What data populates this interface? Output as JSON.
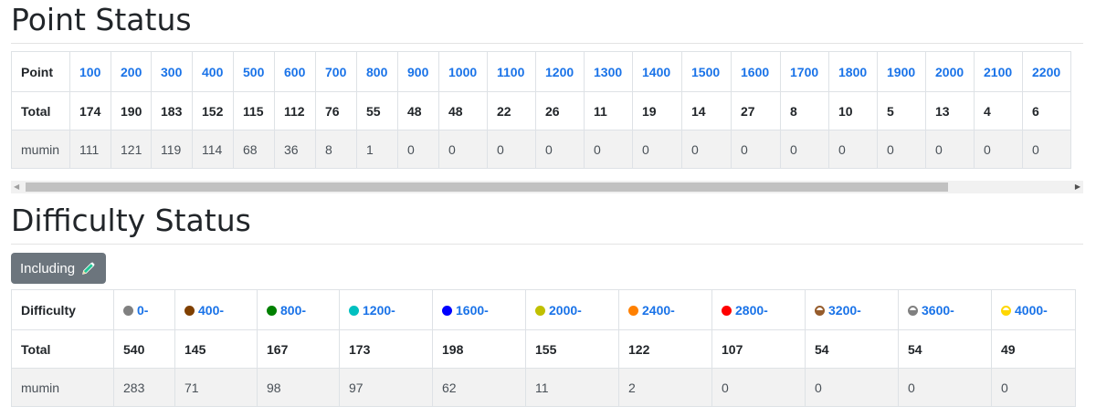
{
  "point_status": {
    "title": "Point Status",
    "header_label": "Point",
    "points": [
      "100",
      "200",
      "300",
      "400",
      "500",
      "600",
      "700",
      "800",
      "900",
      "1000",
      "1100",
      "1200",
      "1300",
      "1400",
      "1500",
      "1600",
      "1700",
      "1800",
      "1900",
      "2000",
      "2100",
      "2200"
    ],
    "total_label": "Total",
    "totals": [
      "174",
      "190",
      "183",
      "152",
      "115",
      "112",
      "76",
      "55",
      "48",
      "48",
      "22",
      "26",
      "11",
      "19",
      "14",
      "27",
      "8",
      "10",
      "5",
      "13",
      "4",
      "6"
    ],
    "user_label": "mumin",
    "user_values": [
      "111",
      "121",
      "119",
      "114",
      "68",
      "36",
      "8",
      "1",
      "0",
      "0",
      "0",
      "0",
      "0",
      "0",
      "0",
      "0",
      "0",
      "0",
      "0",
      "0",
      "0",
      "0"
    ]
  },
  "scrollbar": {
    "left_arrow": "◀",
    "right_arrow": "▶",
    "position_fraction": 0
  },
  "difficulty_status": {
    "title": "Difficulty Status",
    "toggle_label": "Including",
    "header_label": "Difficulty",
    "levels": [
      {
        "label": "0-",
        "color": "#808080"
      },
      {
        "label": "400-",
        "color": "#804000"
      },
      {
        "label": "800-",
        "color": "#008000"
      },
      {
        "label": "1200-",
        "color": "#00c0c0"
      },
      {
        "label": "1600-",
        "color": "#0000ff"
      },
      {
        "label": "2000-",
        "color": "#c0c000"
      },
      {
        "label": "2400-",
        "color": "#ff8000"
      },
      {
        "label": "2800-",
        "color": "#ff0000"
      },
      {
        "label": "3200-",
        "color": "#965c2c"
      },
      {
        "label": "3600-",
        "color": "#808080"
      },
      {
        "label": "4000-",
        "color": "#ffd700"
      }
    ],
    "total_label": "Total",
    "totals": [
      "540",
      "145",
      "167",
      "173",
      "198",
      "155",
      "122",
      "107",
      "54",
      "54",
      "49"
    ],
    "user_label": "mumin",
    "user_values": [
      "283",
      "71",
      "98",
      "97",
      "62",
      "11",
      "2",
      "0",
      "0",
      "0",
      "0"
    ]
  },
  "colors": {
    "link": "#1a73e8",
    "button_bg": "#6c757d",
    "pencil_icon": "#20c997"
  }
}
